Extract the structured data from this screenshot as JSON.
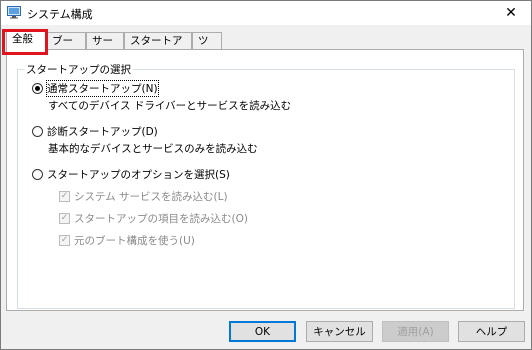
{
  "window": {
    "title": "システム構成",
    "close_symbol": "✕"
  },
  "tabs": [
    {
      "label": "全般",
      "active": true
    },
    {
      "label": "ブート",
      "active": false
    },
    {
      "label": "サービス",
      "active": false
    },
    {
      "label": "スタートアップ",
      "active": false
    },
    {
      "label": "ツール",
      "active": false
    }
  ],
  "startup_group": {
    "legend": "スタートアップの選択",
    "normal": {
      "label": "通常スタートアップ(N)",
      "description": "すべてのデバイス ドライバーとサービスを読み込む",
      "checked": true
    },
    "diagnostic": {
      "label": "診断スタートアップ(D)",
      "description": "基本的なデバイスとサービスのみを読み込む",
      "checked": false
    },
    "selective": {
      "label": "スタートアップのオプションを選択(S)",
      "checked": false
    },
    "options": [
      {
        "label": "システム サービスを読み込む(L)",
        "checked": true
      },
      {
        "label": "スタートアップの項目を読み込む(O)",
        "checked": true
      },
      {
        "label": "元のブート構成を使う(U)",
        "checked": true
      }
    ]
  },
  "buttons": {
    "ok": "OK",
    "cancel": "キャンセル",
    "apply": "適用(A)",
    "help": "ヘルプ"
  },
  "colors": {
    "highlight": "#e0141e",
    "focus_button": "#0078d7"
  }
}
